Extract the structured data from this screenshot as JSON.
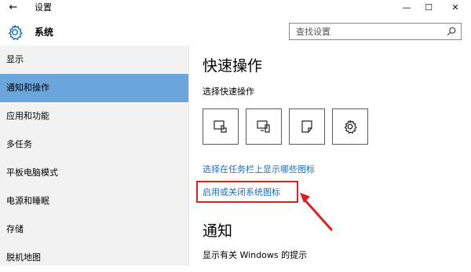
{
  "titlebar": {
    "back_glyph": "←",
    "title": "设置",
    "minimize_glyph": "—",
    "maximize_glyph": "☐",
    "close_glyph": "✕"
  },
  "header": {
    "icon": "gear-icon",
    "title": "系统"
  },
  "search": {
    "placeholder": "查找设置",
    "icon": "search-icon"
  },
  "sidebar": {
    "items": [
      {
        "label": "显示"
      },
      {
        "label": "通知和操作",
        "active": true
      },
      {
        "label": "应用和功能"
      },
      {
        "label": "多任务"
      },
      {
        "label": "平板电脑模式"
      },
      {
        "label": "电源和睡眠"
      },
      {
        "label": "存储"
      },
      {
        "label": "脱机地图"
      }
    ]
  },
  "main": {
    "quick_actions_title": "快速操作",
    "quick_actions_subtitle": "选择快速操作",
    "tiles": [
      {
        "icon": "tablet-mode-icon"
      },
      {
        "icon": "connect-icon"
      },
      {
        "icon": "note-icon"
      },
      {
        "icon": "settings-icon"
      }
    ],
    "link_taskbar_icons": "选择在任务栏上显示哪些图标",
    "link_system_icons": "启用或关闭系统图标",
    "notifications_title": "通知",
    "notifications_text": "显示有关 Windows 的提示"
  },
  "colors": {
    "accent": "#6aa5dc",
    "link": "#1a6fc4",
    "annotation": "#e02020",
    "sidebar_bg": "#f2f2f2"
  }
}
